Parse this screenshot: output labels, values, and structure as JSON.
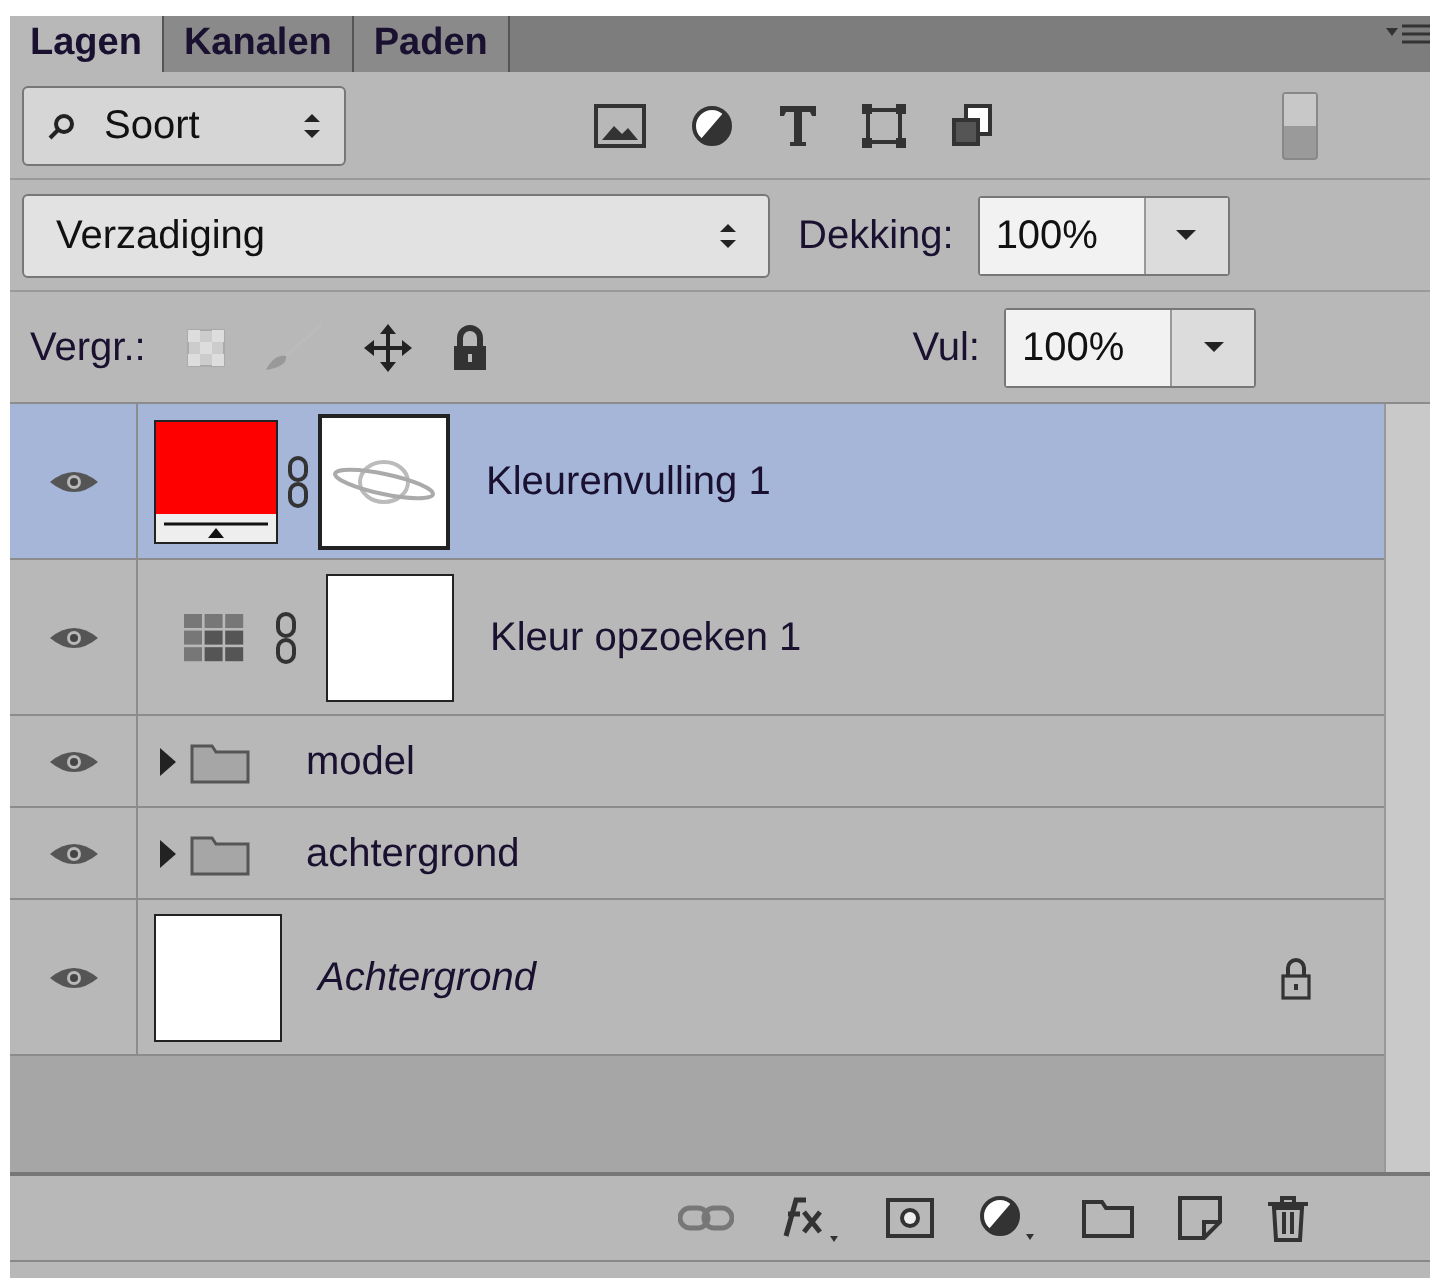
{
  "tabs": [
    {
      "label": "Lagen",
      "selected": true
    },
    {
      "label": "Kanalen",
      "selected": false
    },
    {
      "label": "Paden",
      "selected": false
    }
  ],
  "filter": {
    "label": "Soort"
  },
  "blend": {
    "mode": "Verzadiging",
    "opacity_label": "Dekking:",
    "opacity": "100%"
  },
  "lock": {
    "label": "Vergr.:",
    "fill_label": "Vul:",
    "fill": "100%"
  },
  "layers": [
    {
      "kind": "fill",
      "name": "Kleurenvulling 1",
      "color": "#ff0000",
      "visible": true,
      "selected": true
    },
    {
      "kind": "adjustment",
      "name": "Kleur opzoeken 1",
      "visible": true,
      "selected": false
    },
    {
      "kind": "group",
      "name": "model",
      "visible": true,
      "selected": false
    },
    {
      "kind": "group",
      "name": "achtergrond",
      "visible": true,
      "selected": false
    },
    {
      "kind": "background",
      "name": "Achtergrond",
      "visible": true,
      "selected": false,
      "locked": true
    }
  ]
}
